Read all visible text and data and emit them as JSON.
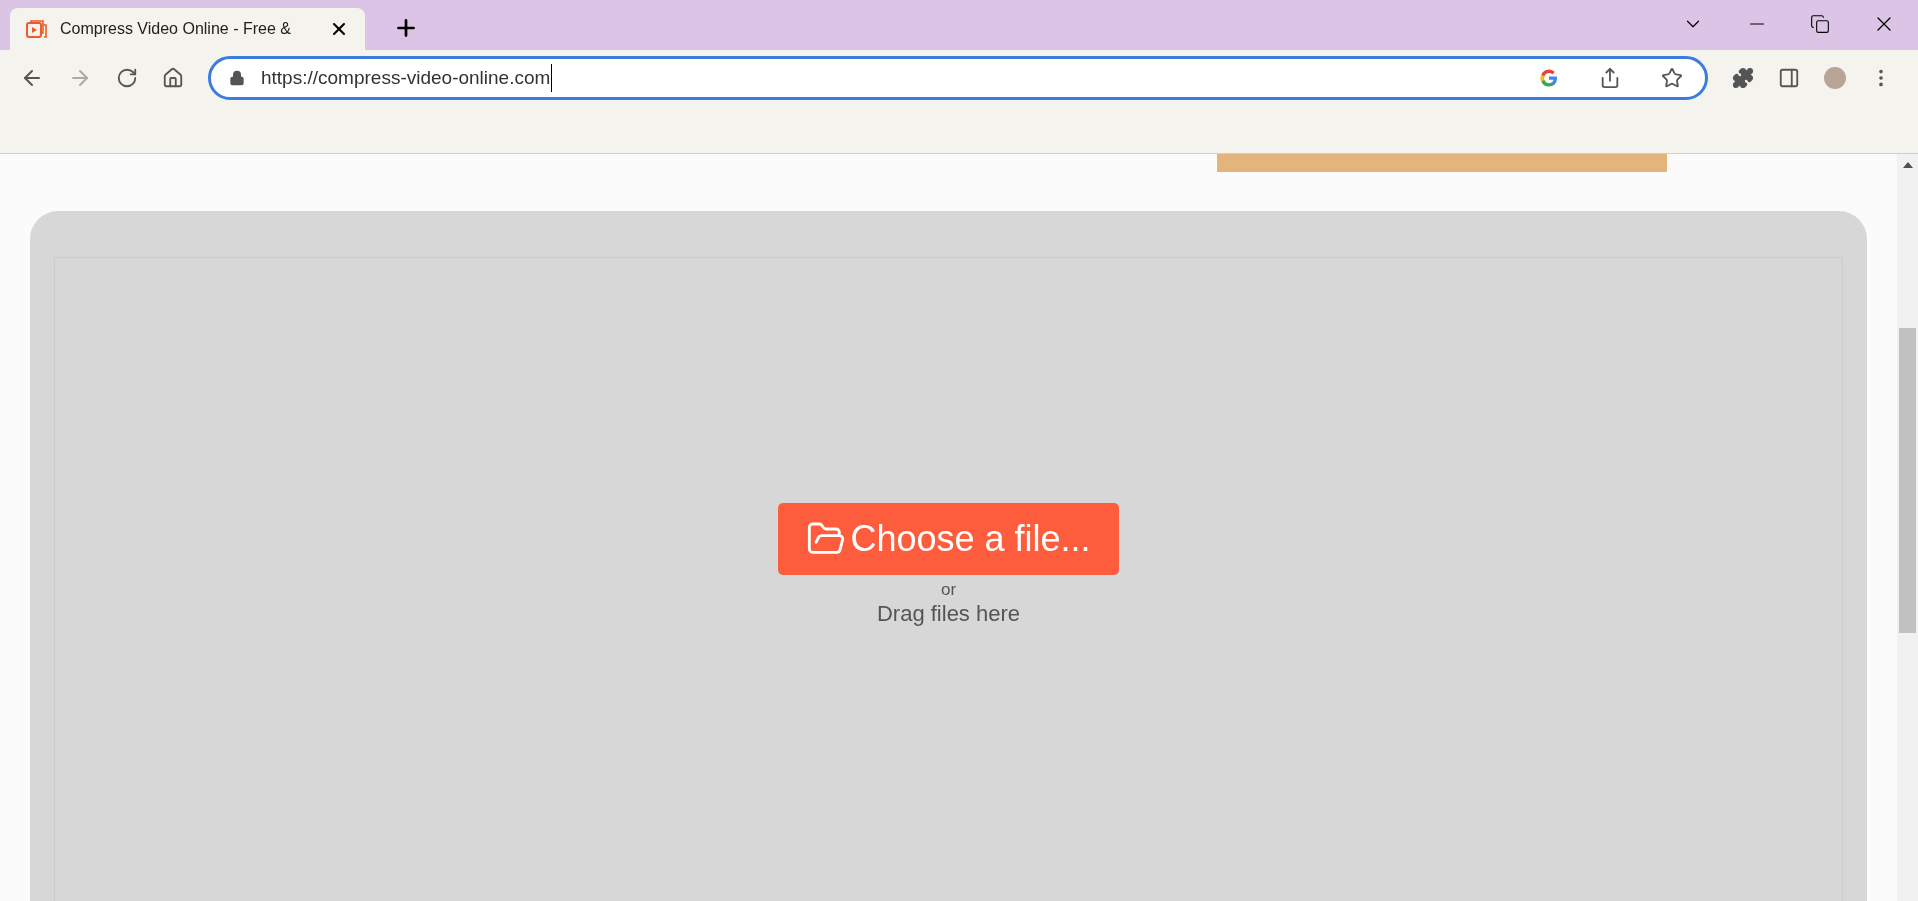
{
  "browser": {
    "tabs": [
      {
        "title": "Compress Video Online - Free &",
        "selected": true
      }
    ],
    "address": "https://compress-video-online.com"
  },
  "upload": {
    "button": "Choose a file...",
    "separator": "or",
    "hint": "Drag files here"
  }
}
